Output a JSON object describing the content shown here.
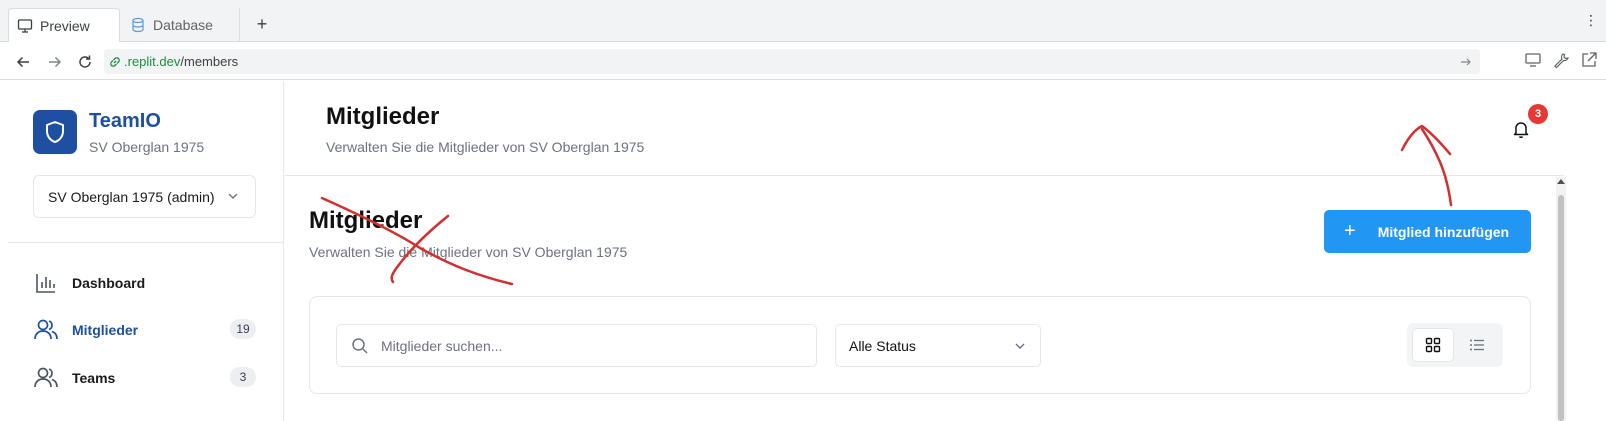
{
  "browser": {
    "tabs": [
      {
        "label": "Preview",
        "icon": "monitor-icon",
        "active": true
      },
      {
        "label": "Database",
        "icon": "database-icon",
        "active": false
      }
    ],
    "new_tab": "+",
    "menu": "⋮",
    "url_domain": ".replit.dev",
    "url_path": "/members"
  },
  "sidebar": {
    "brand_name": "TeamIO",
    "brand_sub": "SV Oberglan 1975",
    "club_select": "SV Oberglan 1975 (admin)",
    "items": [
      {
        "label": "Dashboard",
        "icon": "bar-chart-icon",
        "badge": ""
      },
      {
        "label": "Mitglieder",
        "icon": "users-icon",
        "badge": "19",
        "active": true
      },
      {
        "label": "Teams",
        "icon": "team-icon",
        "badge": "3"
      }
    ]
  },
  "header": {
    "title": "Mitglieder",
    "subtitle": "Verwalten Sie die Mitglieder von SV Oberglan 1975",
    "notification_count": "3"
  },
  "main": {
    "title": "Mitglieder",
    "subtitle": "Verwalten Sie die Mitglieder von SV Oberglan 1975",
    "add_button": "Mitglied hinzufügen",
    "add_plus": "+",
    "search_placeholder": "Mitglieder suchen...",
    "status_filter": "Alle Status"
  },
  "colors": {
    "brand": "#1e4fa0",
    "primary_button": "#2196f3",
    "annotation": "#d32f2f"
  }
}
